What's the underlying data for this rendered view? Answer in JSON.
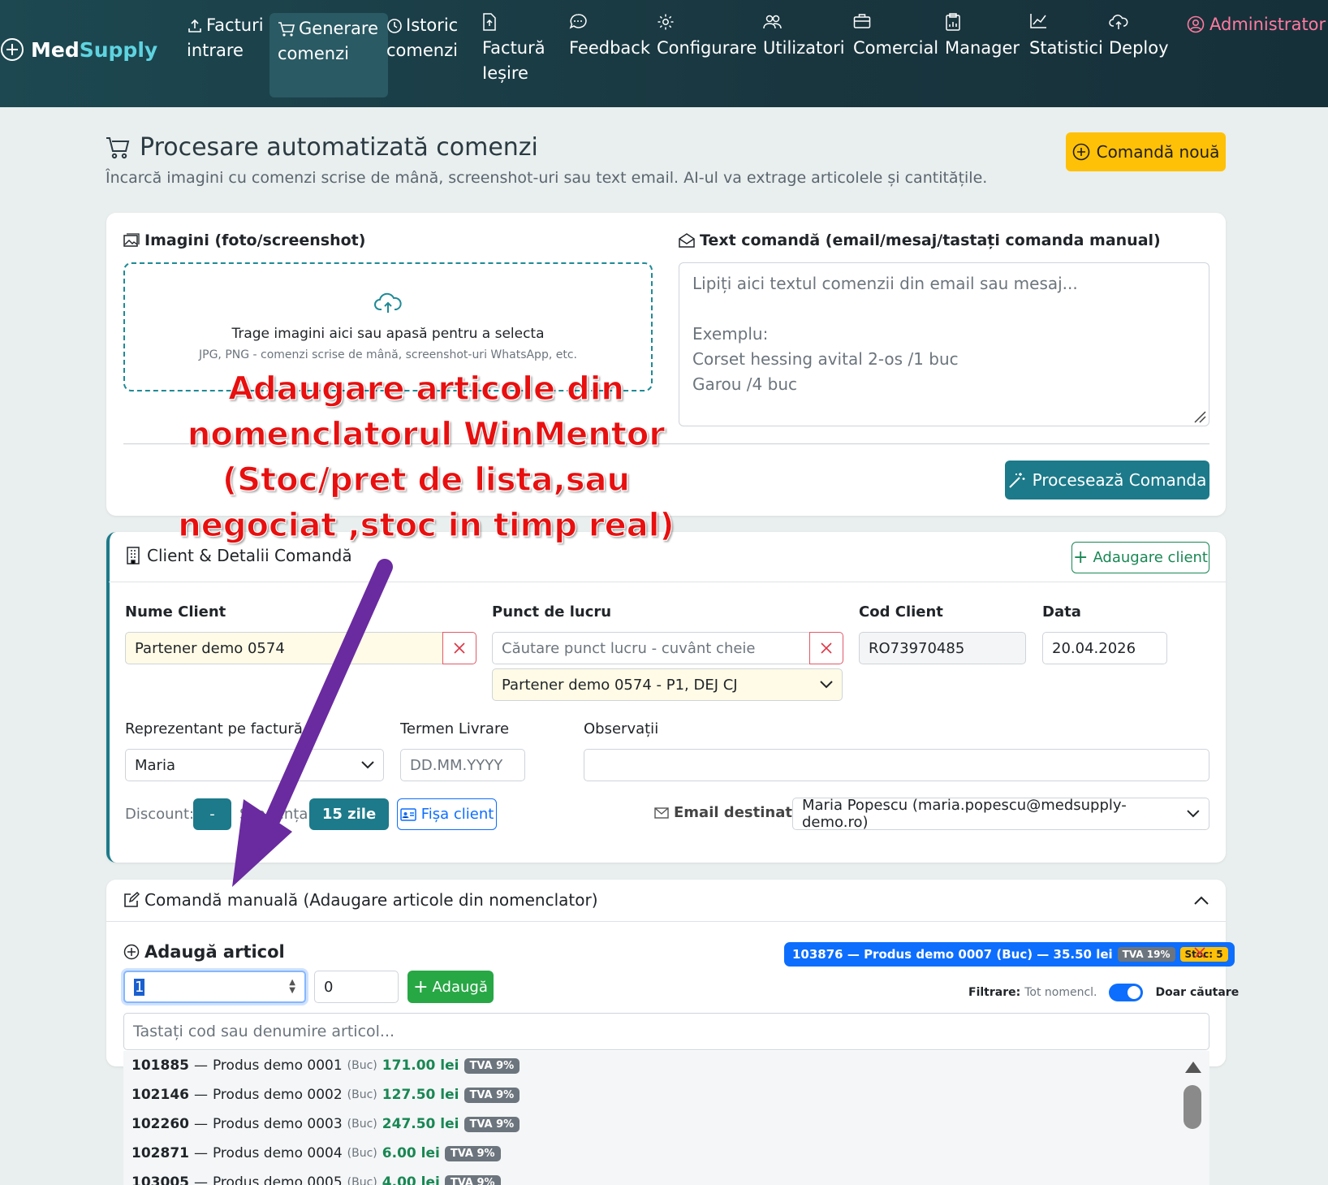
{
  "brand": {
    "part1": "Med",
    "part2": "Supply"
  },
  "nav": {
    "items": [
      {
        "line1": "Facturi",
        "line2": "intrare",
        "line3": ""
      },
      {
        "line1": "Generare",
        "line2": "comenzi",
        "line3": ""
      },
      {
        "line1": "Istoric",
        "line2": "comenzi",
        "line3": ""
      },
      {
        "line1": "",
        "line2": "Factură",
        "line3": "Ieșire"
      },
      {
        "line1": "",
        "line2": "Feedback",
        "line3": ""
      },
      {
        "line1": "",
        "line2": "Configurare",
        "line3": ""
      },
      {
        "line1": "",
        "line2": "Utilizatori",
        "line3": ""
      },
      {
        "line1": "",
        "line2": "Comercial",
        "line3": ""
      },
      {
        "line1": "",
        "line2": "Manager",
        "line3": ""
      },
      {
        "line1": "",
        "line2": "Statistici",
        "line3": ""
      },
      {
        "line1": "",
        "line2": "Deploy",
        "line3": ""
      }
    ],
    "admin": "Administrator"
  },
  "header": {
    "title": "Procesare automatizată comenzi",
    "subtitle": "Încarcă imagini cu comenzi scrise de mână, screenshot-uri sau text email. AI-ul va extrage articolele și cantitățile.",
    "new_order": "Comandă nouă"
  },
  "upload": {
    "images_title": "Imagini (foto/screenshot)",
    "drop_main": "Trage imagini aici sau apasă pentru a selecta",
    "drop_hint": "JPG, PNG - comenzi scrise de mână, screenshot-uri WhatsApp, etc.",
    "text_title": "Text comandă (email/mesaj/tastați comanda manual)",
    "text_placeholder": "Lipiți aici textul comenzii din email sau mesaj...\n\nExemplu:\nCorset hessing avital 2-os /1 buc\nGarou /4 buc",
    "process_btn": "Procesează Comanda"
  },
  "annotation": {
    "line1": "Adaugare articole din",
    "line2": "nomenclatorul WinMentor",
    "line3": "(Stoc/pret de lista,sau",
    "line4": "negociat ,stoc in timp real)"
  },
  "client": {
    "title": "Client & Detalii Comandă",
    "add_client": "Adaugare client",
    "name_label": "Nume Client",
    "name_value": "Partener demo 0574",
    "workpoint_label": "Punct de lucru",
    "workpoint_placeholder": "Căutare punct lucru - cuvânt cheie",
    "workpoint_selected": "Partener demo 0574 - P1, DEJ CJ",
    "code_label": "Cod Client",
    "code_value": "RO73970485",
    "date_label": "Data",
    "date_value": "20.04.2026",
    "rep_label": "Reprezentant pe factură",
    "rep_value": "Maria",
    "delivery_label": "Termen Livrare",
    "delivery_placeholder": "DD.MM.YYYY",
    "notes_label": "Observații",
    "discount_label": "Discount:",
    "discount_value": "-",
    "due_label": "Scadența:",
    "due_value": "15 zile",
    "client_sheet": "Fișa client",
    "email_label": "Email destinatar:",
    "email_value": "Maria Popescu (maria.popescu@medsupply-demo.ro)"
  },
  "manual": {
    "title": "Comandă manuală (Adaugare articole din nomenclator)",
    "add_title": "Adaugă articol",
    "qty": "1",
    "price": "0",
    "add_btn": "Adaugă",
    "selected": {
      "text": "103876 — Produs demo 0007 (Buc) — 35.50 lei",
      "tva": "TVA 19%",
      "stoc": "Stoc: 5"
    },
    "filter_label": "Filtrare:",
    "filter_value": "Tot nomencl.",
    "filter_right": "Doar căutare",
    "search_placeholder": "Tastați cod sau denumire articol...",
    "items": [
      {
        "code": "101885",
        "name": "Produs demo 0001",
        "unit": "(Buc)",
        "price": "171.00 lei",
        "tva": "TVA 9%"
      },
      {
        "code": "102146",
        "name": "Produs demo 0002",
        "unit": "(Buc)",
        "price": "127.50 lei",
        "tva": "TVA 9%"
      },
      {
        "code": "102260",
        "name": "Produs demo 0003",
        "unit": "(Buc)",
        "price": "247.50 lei",
        "tva": "TVA 9%"
      },
      {
        "code": "102871",
        "name": "Produs demo 0004",
        "unit": "(Buc)",
        "price": "6.00 lei",
        "tva": "TVA 9%"
      },
      {
        "code": "103005",
        "name": "Produs demo 0005",
        "unit": "(Buc)",
        "price": "4.00 lei",
        "tva": "TVA 9%"
      }
    ]
  },
  "colors": {
    "nav": "#19363f",
    "teal": "#1c7a8a",
    "yellow": "#ffc107",
    "blue": "#0d6efd",
    "green": "#28a745"
  }
}
